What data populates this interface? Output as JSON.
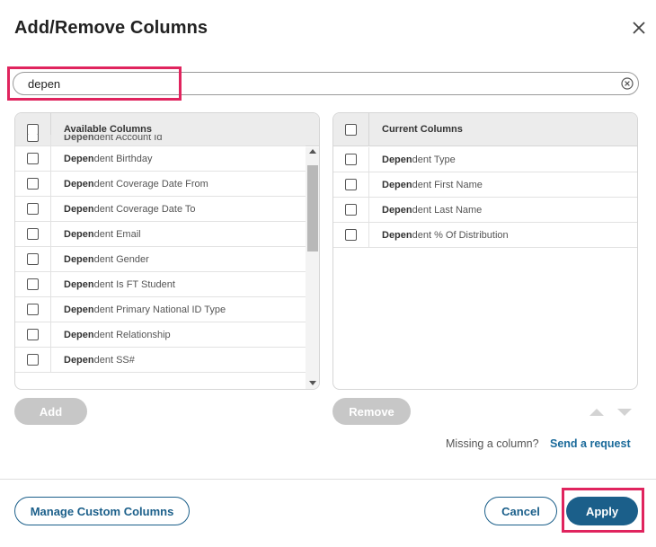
{
  "dialog": {
    "title": "Add/Remove Columns",
    "close_icon": "close-icon"
  },
  "search": {
    "value": "depen",
    "clear_icon": "clear-circle-icon"
  },
  "available": {
    "header": "Available Columns",
    "partial_item": {
      "match": "Depen",
      "rest": "dent Account Id"
    },
    "items": [
      {
        "match": "Depen",
        "rest": "dent Birthday"
      },
      {
        "match": "Depen",
        "rest": "dent Coverage Date From"
      },
      {
        "match": "Depen",
        "rest": "dent Coverage Date To"
      },
      {
        "match": "Depen",
        "rest": "dent Email"
      },
      {
        "match": "Depen",
        "rest": "dent Gender"
      },
      {
        "match": "Depen",
        "rest": "dent Is FT Student"
      },
      {
        "match": "Depen",
        "rest": "dent Primary National ID Type"
      },
      {
        "match": "Depen",
        "rest": "dent Relationship"
      },
      {
        "match": "Depen",
        "rest": "dent SS#"
      }
    ],
    "add_label": "Add"
  },
  "current": {
    "header": "Current Columns",
    "items": [
      {
        "match": "Depen",
        "rest": "dent Type"
      },
      {
        "match": "Depen",
        "rest": "dent First Name"
      },
      {
        "match": "Depen",
        "rest": "dent Last Name"
      },
      {
        "match": "Depen",
        "rest": "dent % Of Distribution"
      }
    ],
    "remove_label": "Remove"
  },
  "footer_help": {
    "missing_text": "Missing a column?",
    "link_text": "Send a request"
  },
  "actions": {
    "manage_label": "Manage Custom Columns",
    "cancel_label": "Cancel",
    "apply_label": "Apply"
  },
  "colors": {
    "primary": "#1b5f8a",
    "highlight": "#e0245e",
    "disabled": "#c7c7c7"
  }
}
